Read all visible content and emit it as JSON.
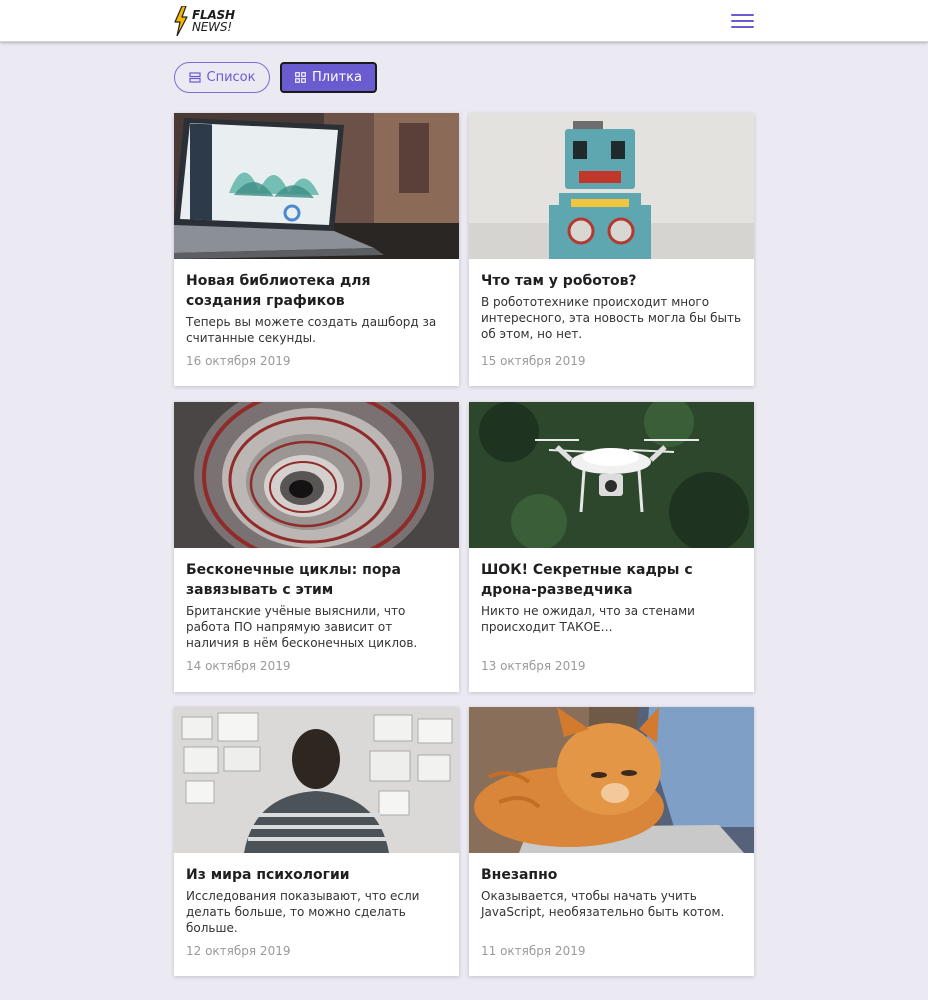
{
  "logo": {
    "line1": "FLASH",
    "line2": "NEWS!"
  },
  "view_toggle": {
    "list_label": "Список",
    "grid_label": "Плитка"
  },
  "colors": {
    "accent": "#6a5bd0",
    "background": "#ebe9f2",
    "bolt": "#f5b800"
  },
  "articles": [
    {
      "title": "Новая библиотека для создания графиков",
      "text": "Теперь вы можете создать дашборд за считанные секунды.",
      "date": "16 октября 2019"
    },
    {
      "title": "Что там у роботов?",
      "text": "В робототехнике происходит много интересного, эта новость могла бы быть об этом, но нет.",
      "date": "15 октября 2019"
    },
    {
      "title": "Бесконечные циклы: пора завязывать с этим",
      "text": "Британские учёные выяснили, что работа ПО напрямую зависит от наличия в нём бесконечных циклов.",
      "date": "14 октября 2019"
    },
    {
      "title": "ШОК! Секретные кадры с дрона-разведчика",
      "text": "Никто не ожидал, что за стенами происходит ТАКОЕ…",
      "date": "13 октября 2019"
    },
    {
      "title": "Из мира психологии",
      "text": "Исследования показывают, что если делать больше, то можно сделать больше.",
      "date": "12 октября 2019"
    },
    {
      "title": "Внезапно",
      "text": "Оказывается, чтобы начать учить JavaScript, необязательно быть котом.",
      "date": "11 октября 2019"
    }
  ]
}
